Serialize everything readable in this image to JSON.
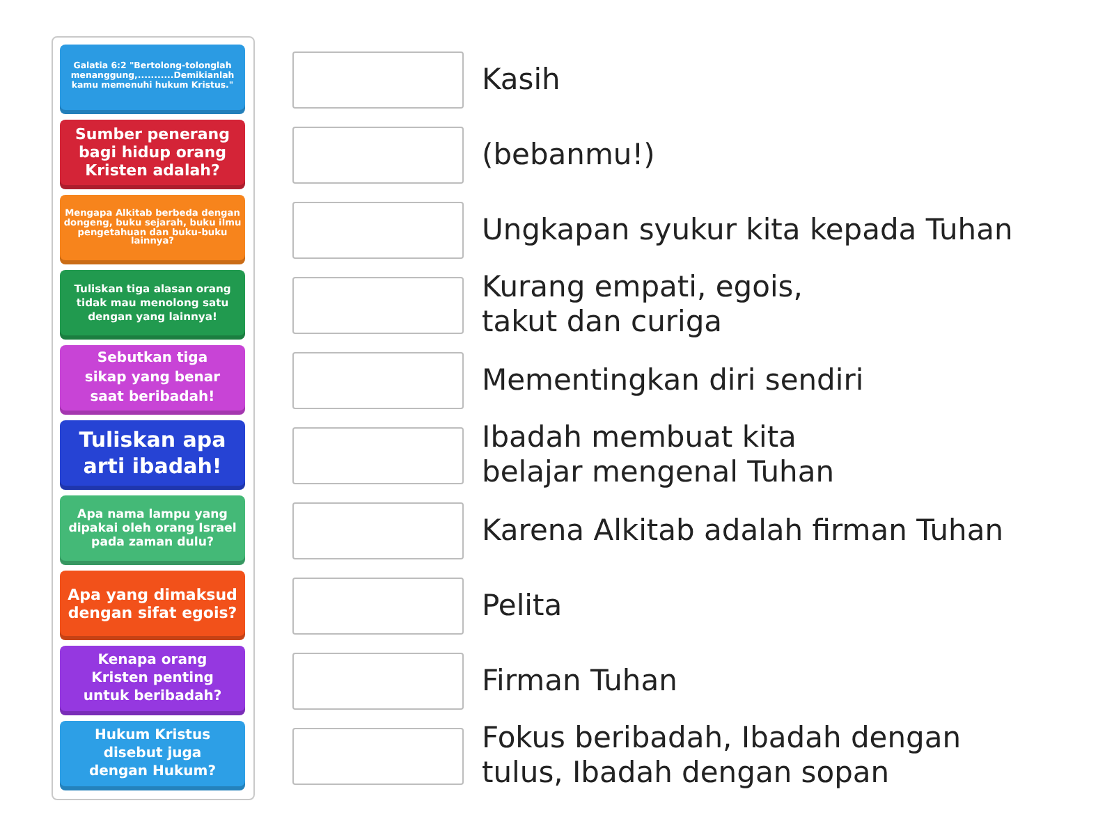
{
  "questions": [
    {
      "text": "Galatia 6:2 \"Bertolong-tolonglah menanggung,...........Demikianlah kamu memenuhi hukum Kristus.\"",
      "color": "#2b9be3"
    },
    {
      "text": "Sumber penerang bagi hidup orang Kristen adalah?",
      "color": "#d42437"
    },
    {
      "text": "Mengapa Alkitab berbeda dengan dongeng, buku sejarah, buku ilmu pengetahuan dan buku-buku lainnya?",
      "color": "#f7841c"
    },
    {
      "text": "Tuliskan tiga alasan orang tidak mau menolong satu dengan yang lainnya!",
      "color": "#219a4f"
    },
    {
      "text": "Sebutkan tiga sikap yang benar saat beribadah!",
      "color": "#c844d6"
    },
    {
      "text": "Tuliskan apa arti ibadah!",
      "color": "#2643d4"
    },
    {
      "text": "Apa nama lampu yang dipakai oleh orang Israel pada zaman dulu?",
      "color": "#44b977"
    },
    {
      "text": "Apa yang dimaksud dengan sifat egois?",
      "color": "#f2511a"
    },
    {
      "text": "Kenapa orang Kristen penting untuk beribadah?",
      "color": "#9538e0"
    },
    {
      "text": "Hukum Kristus disebut juga dengan Hukum?",
      "color": "#2d9fe6"
    }
  ],
  "answers": [
    {
      "text": "Kasih"
    },
    {
      "text": "(bebanmu!)"
    },
    {
      "text": "Ungkapan syukur kita kepada Tuhan"
    },
    {
      "text": "Kurang empati, egois,\ntakut dan curiga"
    },
    {
      "text": "Mementingkan diri sendiri"
    },
    {
      "text": "Ibadah membuat kita\nbelajar mengenal Tuhan"
    },
    {
      "text": "Karena Alkitab adalah firman Tuhan"
    },
    {
      "text": "Pelita"
    },
    {
      "text": "Firman Tuhan"
    },
    {
      "text": "Fokus beribadah, Ibadah dengan\ntulus, Ibadah dengan sopan"
    }
  ]
}
